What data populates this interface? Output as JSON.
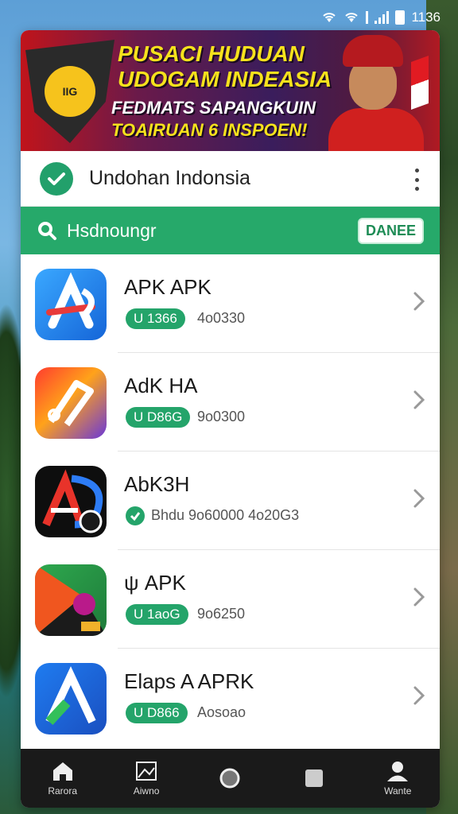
{
  "status_bar": {
    "time": "1136"
  },
  "banner": {
    "logo_text": "IIG",
    "headline_line1": "PUSACI HUDUAN",
    "headline_line2": "UDOGAM INDEASIA",
    "sub_line1": "FEDMATS SAPANGKUIN",
    "sub_line2": "TOAIRUAN 6 INSPOEN!"
  },
  "header": {
    "title": "Undohan Indonsia"
  },
  "search": {
    "text": "Hsdnoungr",
    "button_label": "DANEE"
  },
  "apps": [
    {
      "name": "APK APK",
      "badge": "U 1366",
      "meta": "4o0330"
    },
    {
      "name": "AdK HA",
      "badge": "U D86G",
      "meta": "9o0300"
    },
    {
      "name": "AbK3H",
      "badge": "",
      "meta": "Bhdu  9o60000  4o20G3",
      "verified": true
    },
    {
      "name": "ψ APK",
      "badge": "U 1aoG",
      "meta": "9o6250"
    },
    {
      "name": "Elaps A APRK",
      "badge": "U D866",
      "meta": "Aosoao"
    }
  ],
  "bottom_nav": [
    {
      "label": "Rarora",
      "icon": "home-icon"
    },
    {
      "label": "Aiwno",
      "icon": "gallery-icon"
    },
    {
      "label": "",
      "icon": "circle-icon"
    },
    {
      "label": "",
      "icon": "square-icon"
    },
    {
      "label": "Wante",
      "icon": "profile-icon"
    }
  ],
  "colors": {
    "accent": "#26a96a",
    "nav_bg": "#1a1a1a"
  }
}
